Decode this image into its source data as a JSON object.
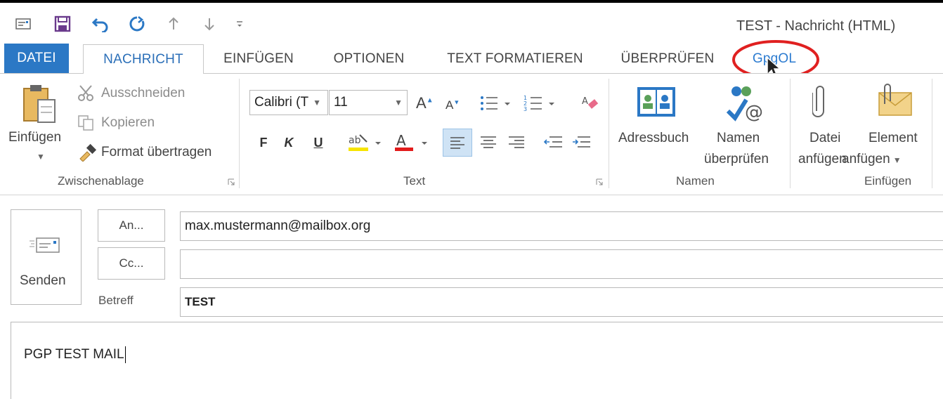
{
  "window": {
    "title": "TEST - Nachricht (HTML)"
  },
  "tabs": [
    "DATEI",
    "NACHRICHT",
    "EINFÜGEN",
    "OPTIONEN",
    "TEXT FORMATIEREN",
    "ÜBERPRÜFEN",
    "GpgOL"
  ],
  "ribbon": {
    "clipboard": {
      "paste_label": "Einfügen",
      "cut_label": "Ausschneiden",
      "copy_label": "Kopieren",
      "format_painter_label": "Format übertragen",
      "group_label": "Zwischenablage"
    },
    "text": {
      "font_name": "Calibri (T",
      "font_size": "11",
      "bold": "F",
      "italic": "K",
      "underline": "U",
      "group_label": "Text"
    },
    "names": {
      "address_book_label": "Adressbuch",
      "check_names_line1": "Namen",
      "check_names_line2": "überprüfen",
      "group_label": "Namen"
    },
    "insert": {
      "attach_file_line1": "Datei",
      "attach_file_line2": "anfügen",
      "attach_item_line1": "Element",
      "attach_item_line2": "anfügen",
      "group_label": "Einfügen"
    }
  },
  "compose": {
    "send_label": "Senden",
    "to_button": "An...",
    "cc_button": "Cc...",
    "subject_label": "Betreff",
    "to_value": "max.mustermann@mailbox.org",
    "cc_value": "",
    "subject_value": "TEST",
    "body_text": "PGP TEST MAIL"
  },
  "colors": {
    "accent": "#2b78c5",
    "highlight_circle": "#e02020",
    "highlight_yellow": "#f7e400",
    "font_red": "#e21b1b"
  }
}
